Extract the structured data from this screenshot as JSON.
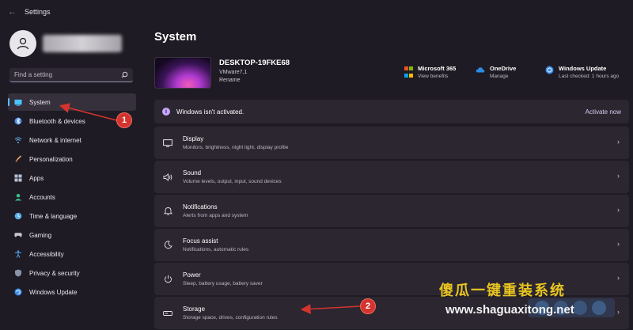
{
  "window": {
    "title": "Settings",
    "back_glyph": "←"
  },
  "sidebar": {
    "search_placeholder": "Find a setting",
    "items": [
      {
        "label": "System",
        "icon": "system-icon",
        "active": true
      },
      {
        "label": "Bluetooth & devices",
        "icon": "bluetooth-icon"
      },
      {
        "label": "Network & internet",
        "icon": "network-icon"
      },
      {
        "label": "Personalization",
        "icon": "brush-icon"
      },
      {
        "label": "Apps",
        "icon": "apps-icon"
      },
      {
        "label": "Accounts",
        "icon": "accounts-icon"
      },
      {
        "label": "Time & language",
        "icon": "clock-icon"
      },
      {
        "label": "Gaming",
        "icon": "gaming-icon"
      },
      {
        "label": "Accessibility",
        "icon": "accessibility-icon"
      },
      {
        "label": "Privacy & security",
        "icon": "shield-icon"
      },
      {
        "label": "Windows Update",
        "icon": "update-icon"
      }
    ]
  },
  "main": {
    "title": "System",
    "device": {
      "name": "DESKTOP-19FKE68",
      "model": "VMware7,1",
      "rename": "Rename"
    },
    "quick_links": [
      {
        "title": "Microsoft 365",
        "sub": "View benefits",
        "icon": "microsoft-logo-icon"
      },
      {
        "title": "OneDrive",
        "sub": "Manage",
        "icon": "cloud-icon"
      },
      {
        "title": "Windows Update",
        "sub": "Last checked: 1 hours ago",
        "icon": "sync-icon"
      }
    ],
    "activation": {
      "message": "Windows isn't activated.",
      "action": "Activate now"
    },
    "settings": [
      {
        "title": "Display",
        "sub": "Monitors, brightness, night light, display profile",
        "icon": "display-icon"
      },
      {
        "title": "Sound",
        "sub": "Volume levels, output, input, sound devices",
        "icon": "speaker-icon"
      },
      {
        "title": "Notifications",
        "sub": "Alerts from apps and system",
        "icon": "bell-icon"
      },
      {
        "title": "Focus assist",
        "sub": "Notifications, automatic rules",
        "icon": "moon-icon"
      },
      {
        "title": "Power",
        "sub": "Sleep, battery usage, battery saver",
        "icon": "power-icon"
      },
      {
        "title": "Storage",
        "sub": "Storage space, drives, configuration rules",
        "icon": "storage-icon"
      }
    ]
  },
  "annotations": {
    "badge_1": "1",
    "badge_2": "2"
  },
  "watermark": {
    "chinese": "傻瓜一键重装系统",
    "url": "www.shaguaxitong.net"
  },
  "colors": {
    "accent": "#4cc2ff",
    "annotation_red": "#d4342e",
    "watermark_yellow": "#e8c520"
  }
}
